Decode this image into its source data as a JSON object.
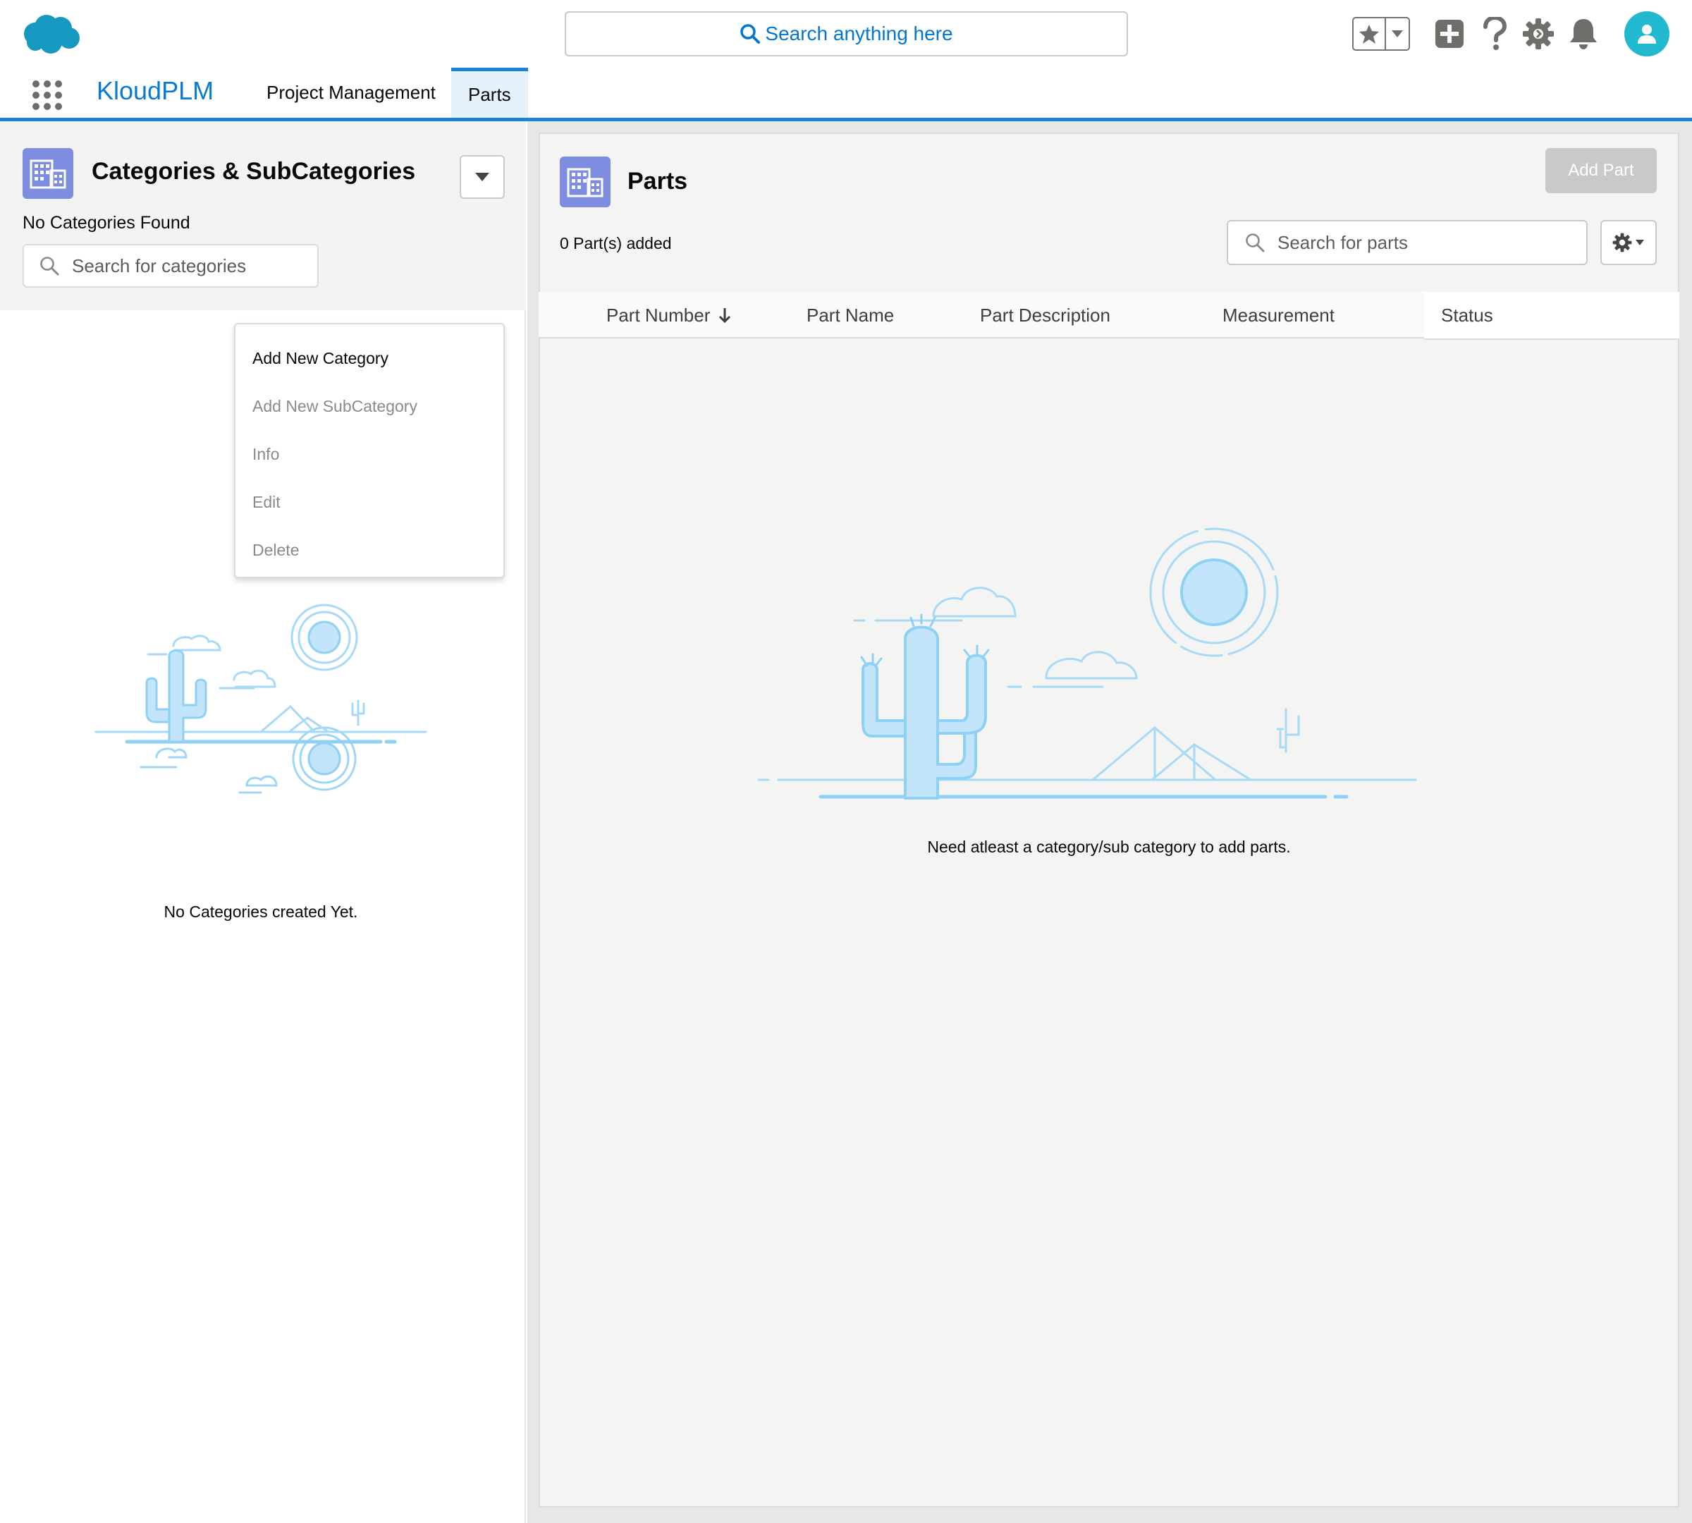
{
  "header": {
    "search_placeholder": "Search anything here"
  },
  "nav": {
    "app_name": "KloudPLM",
    "tabs": [
      {
        "label": "Project Management"
      },
      {
        "label": "Parts"
      }
    ]
  },
  "left_panel": {
    "title": "Categories & SubCategories",
    "status": "No Categories Found",
    "search_placeholder": "Search for categories",
    "menu_items": [
      {
        "label": "Add New Category",
        "enabled": true
      },
      {
        "label": "Add New SubCategory",
        "enabled": false
      },
      {
        "label": "Info",
        "enabled": false
      },
      {
        "label": "Edit",
        "enabled": false
      },
      {
        "label": "Delete",
        "enabled": false
      }
    ],
    "empty_text": "No Categories created Yet."
  },
  "right_panel": {
    "title": "Parts",
    "add_button": "Add Part",
    "count_text": "0 Part(s) added",
    "search_placeholder": "Search for parts",
    "columns": [
      {
        "label": "Part Number"
      },
      {
        "label": "Part Name"
      },
      {
        "label": "Part Description"
      },
      {
        "label": "Measurement"
      },
      {
        "label": "Status"
      }
    ],
    "empty_text": "Need atleast a category/sub category to add parts."
  },
  "colors": {
    "brand_blue": "#0176d3",
    "object_icon": "#7f8de1",
    "avatar": "#22b8cf",
    "illustration_light": "#c2e5fb",
    "illustration_line": "#8fd0f5"
  },
  "icons": [
    "salesforce-cloud-icon",
    "search-icon",
    "star-icon",
    "chevron-down-icon",
    "add-icon",
    "help-icon",
    "setup-gear-icon",
    "bell-icon",
    "user-icon",
    "waffle-icon",
    "building-icon",
    "gear-icon",
    "arrow-down-icon"
  ]
}
